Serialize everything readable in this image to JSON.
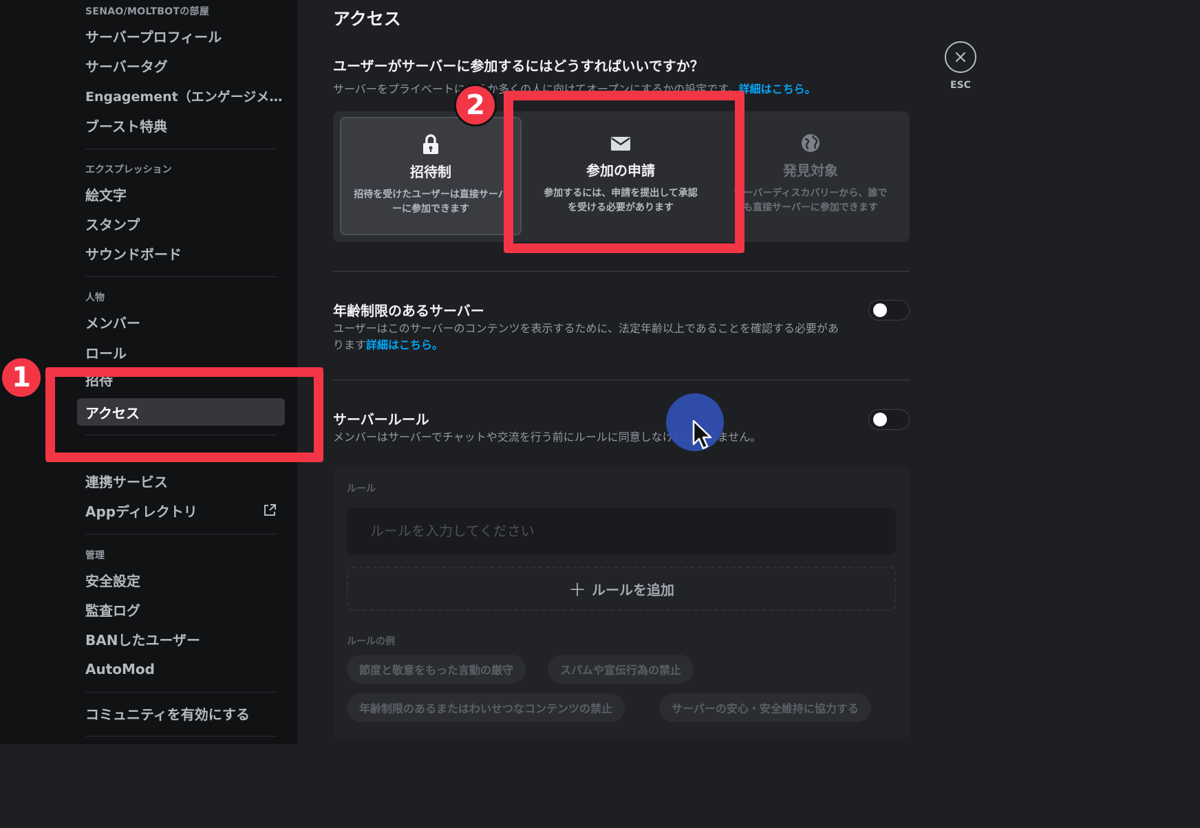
{
  "colors": {
    "accent": "#00a8fc",
    "annotation": "#f23645",
    "cursor_highlight": "#2f4fb0"
  },
  "sidebar": {
    "server_header": "SENAO/MOLTBOTの部屋",
    "items_server": [
      "サーバープロフィール",
      "サーバータグ",
      "Engagement（エンゲージメ…",
      "ブースト特典"
    ],
    "section_expression": "エクスプレッション",
    "items_expression": [
      "絵文字",
      "スタンプ",
      "サウンドボード"
    ],
    "section_people": "人物",
    "items_people": [
      "メンバー",
      "ロール",
      "招待"
    ],
    "active_item": "アクセス",
    "items_apps": [
      "連携サービス",
      "Appディレクトリ"
    ],
    "section_moderation": "管理",
    "items_moderation": [
      "安全設定",
      "監査ログ",
      "BANしたユーザー",
      "AutoMod"
    ],
    "community": "コミュニティを有効にする"
  },
  "main": {
    "title": "アクセス",
    "esc_label": "ESC",
    "question_title": "ユーザーがサーバーに参加するにはどうすればいいですか？",
    "question_desc": "サーバーをプライベートにするか多くの人に向けてオープンにするかの設定です。",
    "learn_more": "詳細はこちら。",
    "options": [
      {
        "icon": "lock-icon",
        "title": "招待制",
        "desc": "招待を受けたユーザーは直接サーバーに参加できます"
      },
      {
        "icon": "mail-icon",
        "title": "参加の申請",
        "desc": "参加するには、申請を提出して承認を受ける必要があります"
      },
      {
        "icon": "globe-icon",
        "title": "発見対象",
        "desc": "サーバーディスカバリーから、誰でも直接サーバーに参加できます"
      }
    ],
    "age_restricted": {
      "title": "年齢制限のあるサーバー",
      "desc": "ユーザーはこのサーバーのコンテンツを表示するために、法定年齢以上であることを確認する必要があります",
      "link": "詳細はこちら。",
      "enabled": false
    },
    "server_rules": {
      "title": "サーバールール",
      "desc": "メンバーはサーバーでチャットや交流を行う前にルールに同意しなければなりません。",
      "enabled": false,
      "rules_label": "ルール",
      "rule_placeholder": "ルールを入力してください",
      "add_rule": "ルールを追加",
      "examples_label": "ルールの例",
      "examples": [
        "節度と敬意をもった言動の厳守",
        "スパムや宣伝行為の禁止",
        "年齢制限のあるまたはわいせつなコンテンツの禁止",
        "サーバーの安心・安全維持に協力する"
      ]
    }
  },
  "annotations": {
    "step1": "1",
    "step2": "2"
  }
}
